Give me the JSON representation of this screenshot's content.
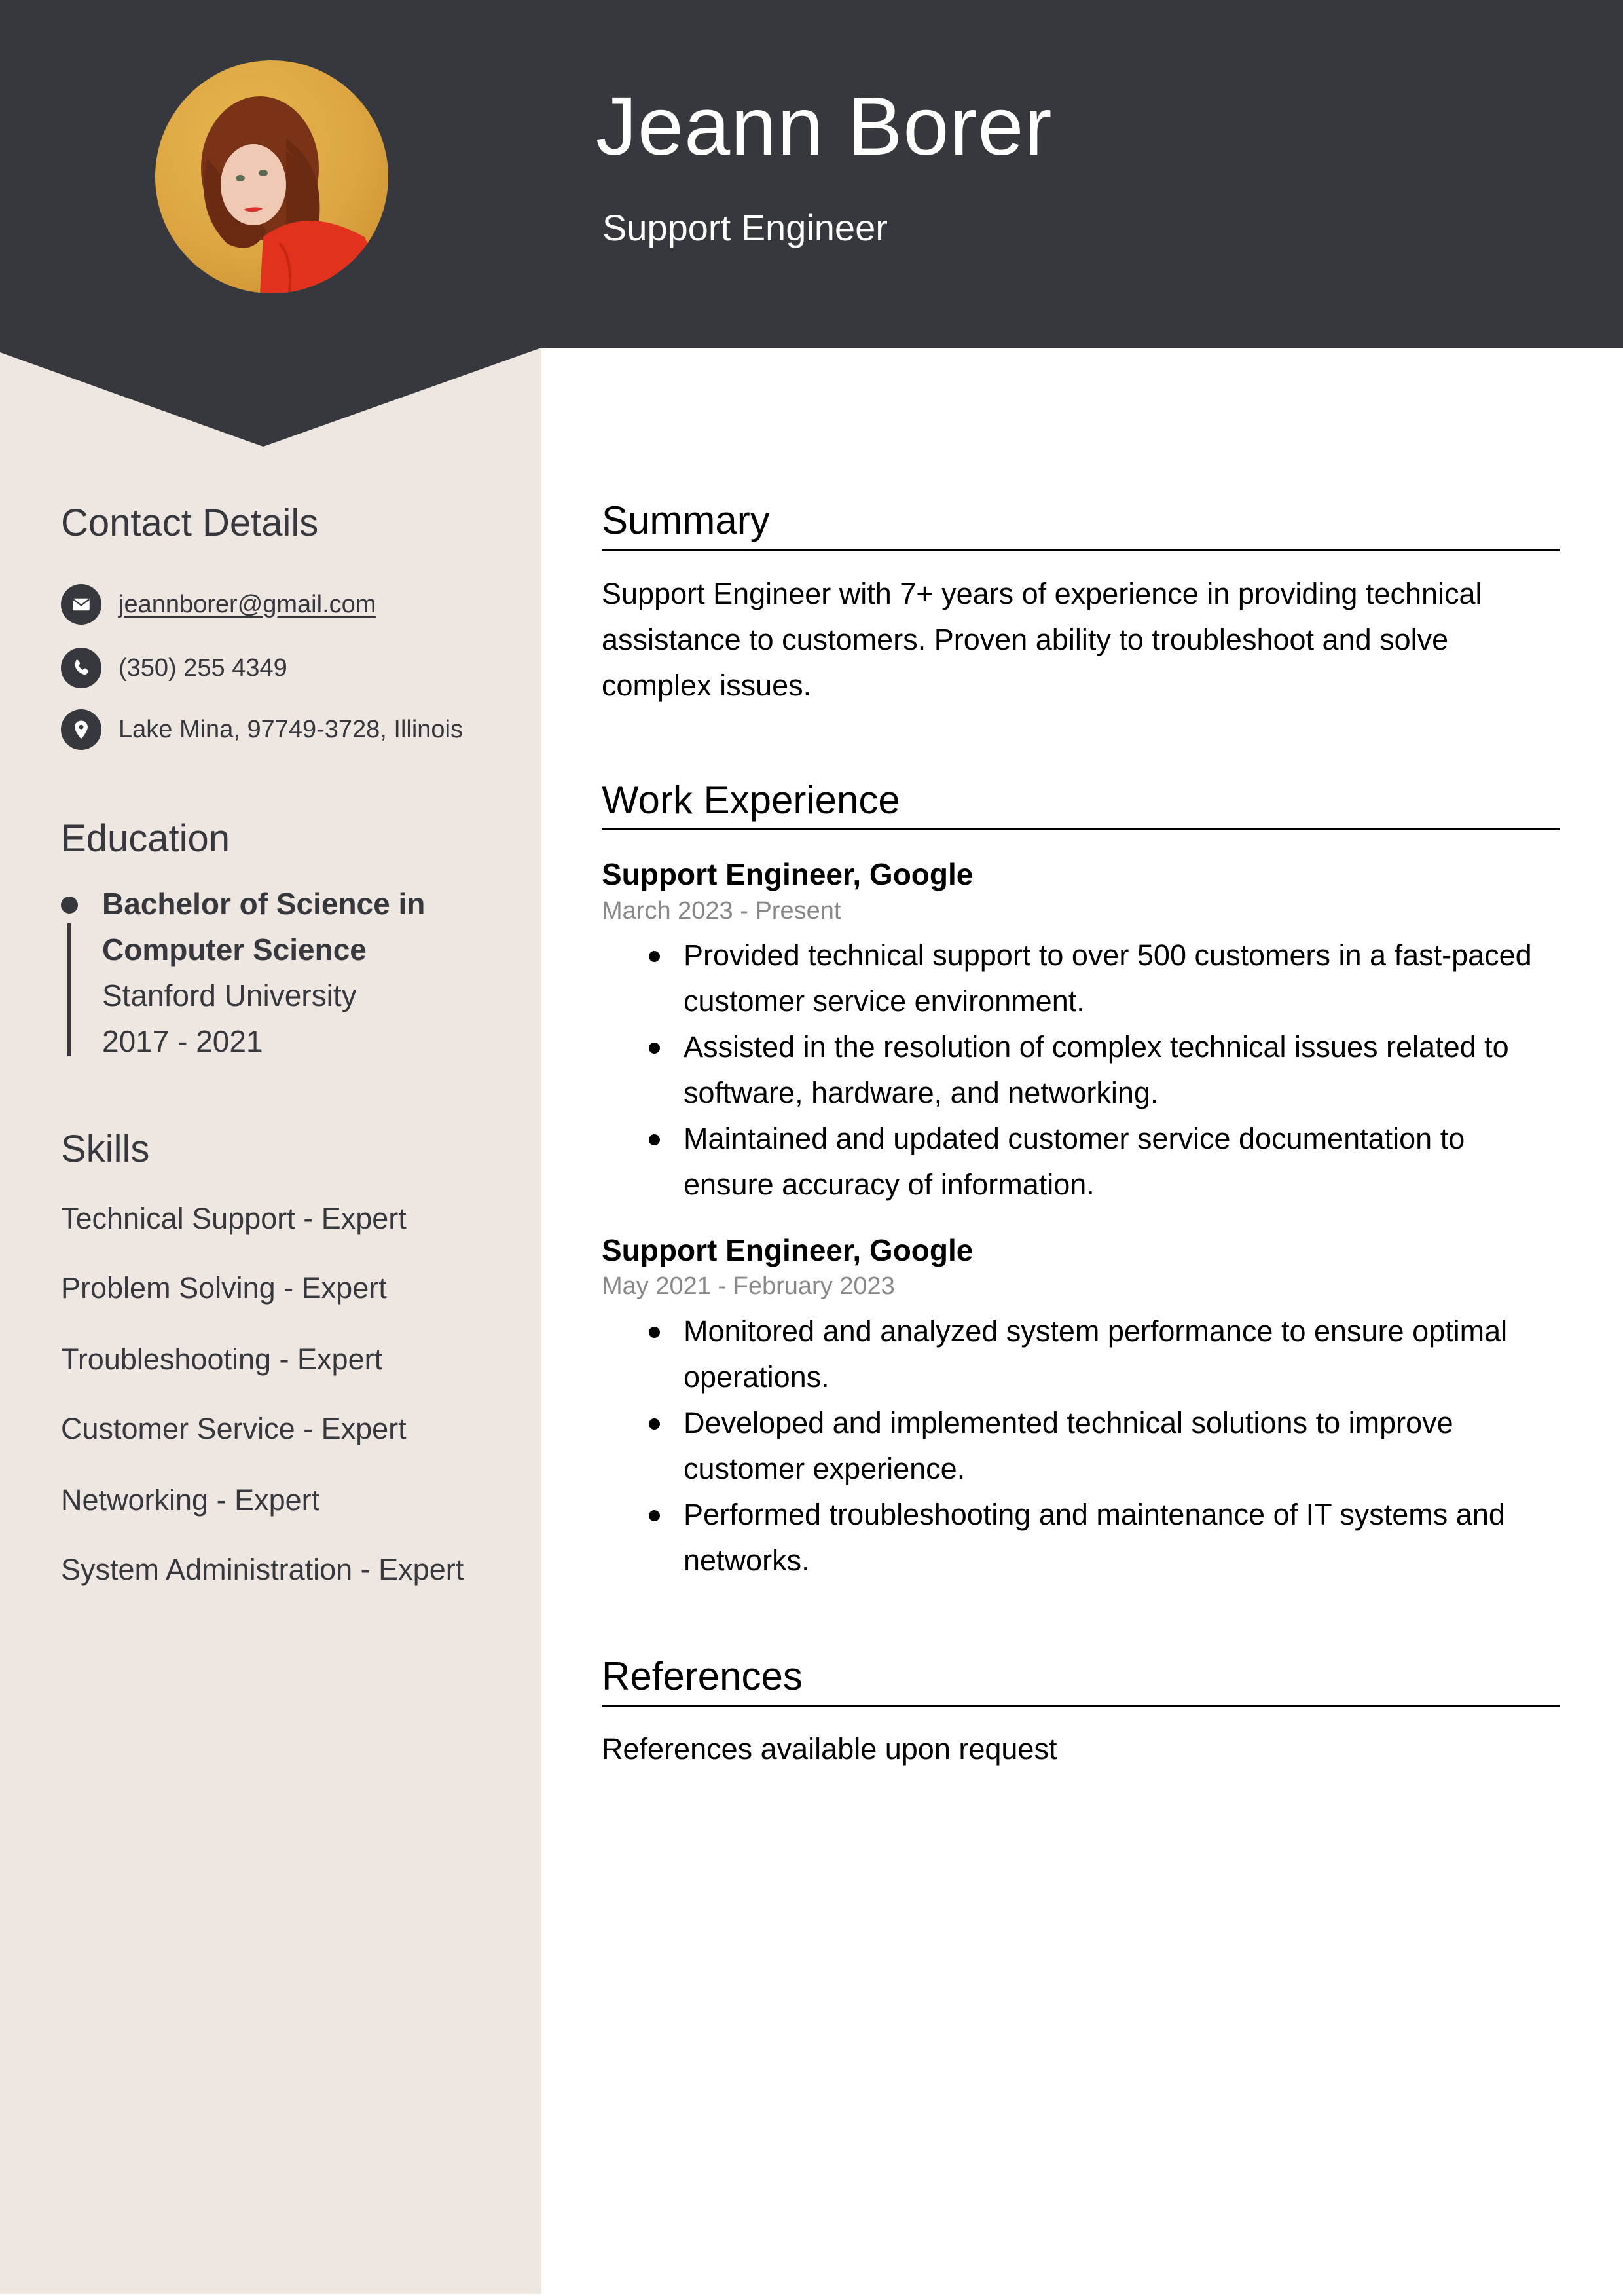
{
  "header": {
    "name": "Jeann Borer",
    "title": "Support Engineer",
    "photo_alt": "Profile photo of a woman with curly auburn hair wearing a red sweater against a yellow background"
  },
  "colors": {
    "header_bg": "#37383e",
    "sidebar_bg": "#ede6e1",
    "accent_text": "#37383e",
    "date_gray": "#888888"
  },
  "sidebar": {
    "contact": {
      "heading": "Contact Details",
      "items": [
        {
          "icon": "envelope-icon",
          "value": "jeannborer@gmail.com"
        },
        {
          "icon": "phone-icon",
          "value": "(350) 255 4349"
        },
        {
          "icon": "map-pin-icon",
          "value": "Lake Mina, 97749-3728, Illinois"
        }
      ]
    },
    "education": {
      "heading": "Education",
      "entries": [
        {
          "degree_line1": "Bachelor of Science in",
          "degree_line2": "Computer Science",
          "school": "Stanford University",
          "years": "2017 - 2021"
        }
      ]
    },
    "skills": {
      "heading": "Skills",
      "items": [
        "Technical Support - Expert",
        "Problem Solving - Expert",
        "Troubleshooting - Expert",
        "Customer Service - Expert",
        "Networking - Expert",
        "System Administration - Expert"
      ]
    }
  },
  "main": {
    "summary": {
      "heading": "Summary",
      "lines": [
        "Support Engineer with 7+ years of experience in providing technical",
        "assistance to customers. Proven ability to troubleshoot and solve",
        "complex issues."
      ]
    },
    "experience": {
      "heading": "Work Experience",
      "jobs": [
        {
          "title": "Support Engineer, Google",
          "dates": "March 2023 - Present",
          "bullets": [
            [
              "Provided technical support to over 500 customers in a fast-paced",
              "customer service environment."
            ],
            [
              "Assisted in the resolution of complex technical issues related to",
              "software, hardware, and networking."
            ],
            [
              "Maintained and updated customer service documentation to",
              "ensure accuracy of information."
            ]
          ]
        },
        {
          "title": "Support Engineer, Google",
          "dates": "May 2021 - February 2023",
          "bullets": [
            [
              "Monitored and analyzed system performance to ensure optimal",
              "operations."
            ],
            [
              "Developed and implemented technical solutions to improve",
              "customer experience."
            ],
            [
              "Performed troubleshooting and maintenance of IT systems and",
              "networks."
            ]
          ]
        }
      ]
    },
    "references": {
      "heading": "References",
      "text": "References available upon request"
    }
  }
}
